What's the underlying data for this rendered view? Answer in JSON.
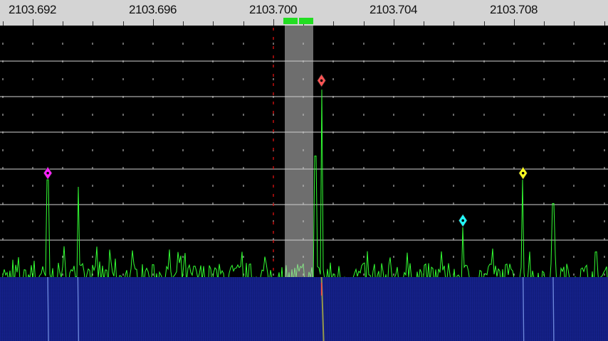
{
  "frequency_scale": {
    "labels": [
      "2103.692",
      "2103.696",
      "2103.700",
      "2103.704",
      "2103.708"
    ],
    "label_values_mhz": [
      2103.692,
      2103.696,
      2103.7,
      2103.704,
      2103.708
    ],
    "unit": "",
    "colors": {
      "background": "#d4d4d4",
      "text": "#111111"
    }
  },
  "tuning": {
    "center_marker_freq": 2103.7,
    "passband_center_freq": 2103.7015,
    "passband_color": "#c8c8c8",
    "tune_bar_color": "#22dd22"
  },
  "markers": [
    {
      "name": "marker-red",
      "freq": 2103.7016,
      "color": "#ff5555",
      "level": 0.9
    },
    {
      "name": "marker-magenta",
      "freq": 2103.6925,
      "color": "#ff22ff",
      "level": 0.51
    },
    {
      "name": "marker-cyan",
      "freq": 2103.7063,
      "color": "#22ffff",
      "level": 0.31
    },
    {
      "name": "marker-yellow",
      "freq": 2103.7083,
      "color": "#ffff22",
      "level": 0.51
    }
  ],
  "spectrum": {
    "trace_color": "#33ff33",
    "grid_color": "#aaaaaa",
    "noise_floor": 0.15,
    "peaks": [
      {
        "freq": 2103.6925,
        "level": 0.5
      },
      {
        "freq": 2103.6935,
        "level": 0.47
      },
      {
        "freq": 2103.7016,
        "level": 0.88
      },
      {
        "freq": 2103.7014,
        "level": 0.6
      },
      {
        "freq": 2103.7063,
        "level": 0.3
      },
      {
        "freq": 2103.7083,
        "level": 0.5
      },
      {
        "freq": 2103.7093,
        "level": 0.4
      }
    ]
  },
  "waterfall": {
    "colors": {
      "background": "#0c1a78",
      "speckle": "#3a52d6",
      "trace": "#cccc33"
    }
  }
}
